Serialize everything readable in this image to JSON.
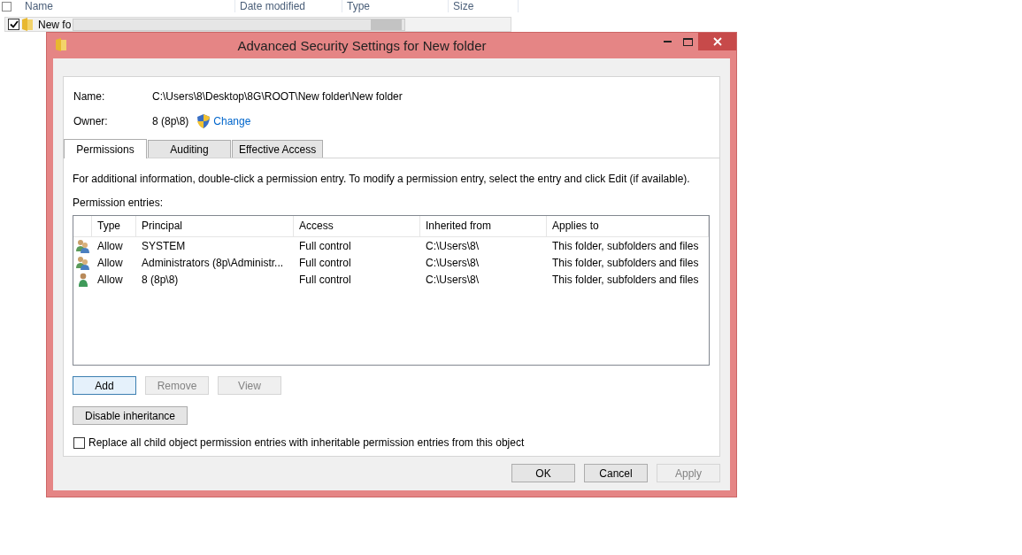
{
  "explorer": {
    "select_all": {
      "checked": false
    },
    "columns": [
      "Name",
      "Date modified",
      "Type",
      "Size"
    ],
    "rows": [
      {
        "name": "New fo",
        "checked": true
      }
    ]
  },
  "dialog": {
    "title": "Advanced Security Settings for New folder",
    "name_label": "Name:",
    "name_value": "C:\\Users\\8\\Desktop\\8G\\ROOT\\New folder\\New folder",
    "owner_label": "Owner:",
    "owner_value": "8 (8p\\8)",
    "change_link": "Change",
    "tabs": [
      {
        "label": "Permissions",
        "selected": true
      },
      {
        "label": "Auditing",
        "selected": false
      },
      {
        "label": "Effective Access",
        "selected": false
      }
    ],
    "info_text": "For additional information, double-click a permission entry. To modify a permission entry, select the entry and click Edit (if available).",
    "entries_label": "Permission entries:",
    "table": {
      "columns": [
        "Type",
        "Principal",
        "Access",
        "Inherited from",
        "Applies to"
      ],
      "rows": [
        {
          "kind": "group",
          "type": "Allow",
          "principal": "SYSTEM",
          "access": "Full control",
          "inherited_from": "C:\\Users\\8\\",
          "applies_to": "This folder, subfolders and files"
        },
        {
          "kind": "group",
          "type": "Allow",
          "principal": "Administrators (8p\\Administr...",
          "access": "Full control",
          "inherited_from": "C:\\Users\\8\\",
          "applies_to": "This folder, subfolders and files"
        },
        {
          "kind": "user",
          "type": "Allow",
          "principal": "8 (8p\\8)",
          "access": "Full control",
          "inherited_from": "C:\\Users\\8\\",
          "applies_to": "This folder, subfolders and files"
        }
      ]
    },
    "entry_buttons": [
      {
        "label": "Add",
        "disabled": false,
        "focused": true
      },
      {
        "label": "Remove",
        "disabled": true,
        "focused": false
      },
      {
        "label": "View",
        "disabled": true,
        "focused": false
      }
    ],
    "disable_inheritance_button": "Disable inheritance",
    "replace_option": {
      "label": "Replace all child object permission entries with inheritable permission entries from this object",
      "checked": false
    },
    "footer_buttons": [
      {
        "label": "OK",
        "disabled": false
      },
      {
        "label": "Cancel",
        "disabled": false
      },
      {
        "label": "Apply",
        "disabled": true
      }
    ]
  }
}
